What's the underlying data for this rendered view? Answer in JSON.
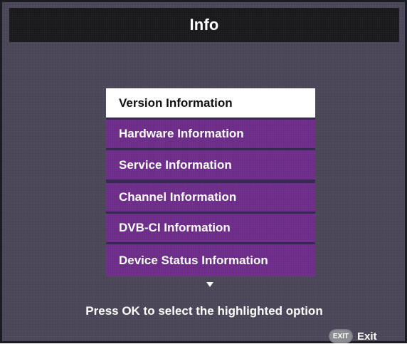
{
  "header": {
    "title": "Info"
  },
  "menu": {
    "items": [
      {
        "label": "Version Information",
        "selected": true
      },
      {
        "label": "Hardware Information",
        "selected": false
      },
      {
        "label": "Service Information",
        "selected": false
      },
      {
        "label": "Channel Information",
        "selected": false
      },
      {
        "label": "DVB-CI Information",
        "selected": false
      },
      {
        "label": "Device Status Information",
        "selected": false
      }
    ],
    "more_indicator_icon": "down-triangle"
  },
  "hint": {
    "text": "Press OK to select the highlighted option"
  },
  "footer": {
    "exit_key_label": "EXIT",
    "exit_label": "Exit",
    "exit_icon": "remote-exit-key"
  },
  "colors": {
    "background": "#4a4658",
    "title_bar": "#16161a",
    "menu_item": "#6a2a86",
    "selected_item": "#ffffff"
  }
}
